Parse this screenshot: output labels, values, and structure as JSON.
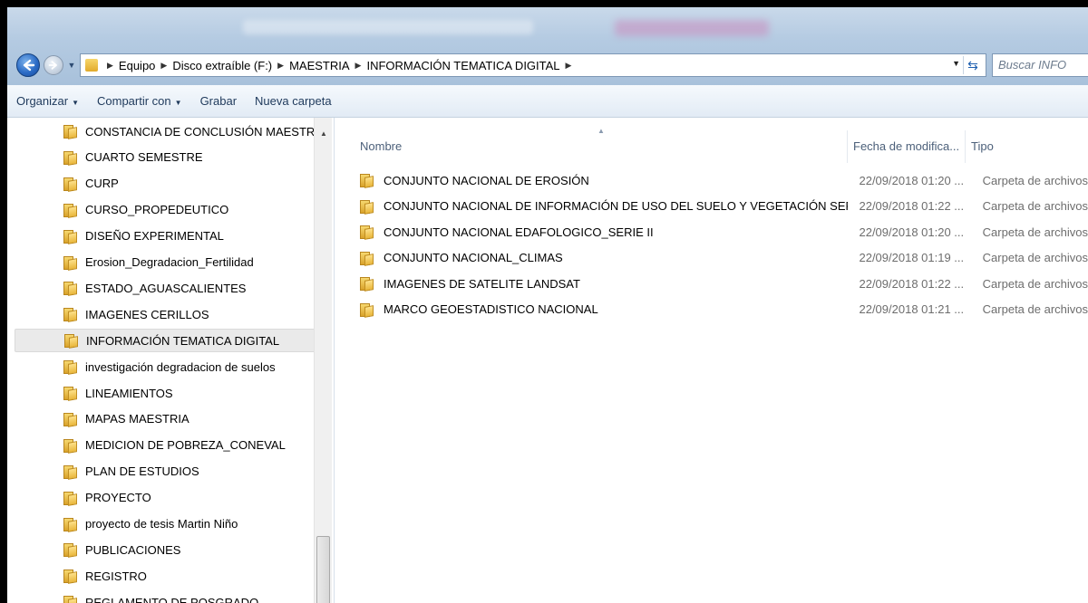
{
  "address": {
    "crumbs": [
      "Equipo",
      "Disco extraíble (F:)",
      "MAESTRIA",
      "INFORMACIÓN TEMATICA DIGITAL"
    ]
  },
  "search": {
    "placeholder": "Buscar INFO"
  },
  "toolbar": {
    "organize": "Organizar",
    "share": "Compartir con",
    "burn": "Grabar",
    "new_folder": "Nueva carpeta"
  },
  "sidebar": {
    "items": [
      "CONSTANCIA DE CONCLUSIÓN MAESTRÍA",
      "CUARTO SEMESTRE",
      "CURP",
      "CURSO_PROPEDEUTICO",
      "DISEÑO EXPERIMENTAL",
      "Erosion_Degradacion_Fertilidad",
      "ESTADO_AGUASCALIENTES",
      "IMAGENES CERILLOS",
      "INFORMACIÓN TEMATICA DIGITAL",
      "investigación degradacion de suelos",
      "LINEAMIENTOS",
      "MAPAS MAESTRIA",
      "MEDICION DE POBREZA_CONEVAL",
      "PLAN DE ESTUDIOS",
      "PROYECTO",
      "proyecto de tesis Martin Niño",
      "PUBLICACIONES",
      "REGISTRO",
      "REGLAMENTO DE POSGRADO"
    ],
    "selected": "INFORMACIÓN TEMATICA DIGITAL"
  },
  "columns": {
    "name": "Nombre",
    "date": "Fecha de modifica...",
    "type": "Tipo"
  },
  "files": [
    {
      "name": "CONJUNTO NACIONAL DE EROSIÓN",
      "date": "22/09/2018 01:20 ...",
      "type": "Carpeta de archivos"
    },
    {
      "name": "CONJUNTO NACIONAL DE INFORMACIÓN DE USO DEL SUELO Y VEGETACIÓN SERIE V",
      "date": "22/09/2018 01:22 ...",
      "type": "Carpeta de archivos"
    },
    {
      "name": "CONJUNTO NACIONAL EDAFOLOGICO_SERIE II",
      "date": "22/09/2018 01:20 ...",
      "type": "Carpeta de archivos"
    },
    {
      "name": "CONJUNTO NACIONAL_CLIMAS",
      "date": "22/09/2018 01:19 ...",
      "type": "Carpeta de archivos"
    },
    {
      "name": "IMAGENES DE SATELITE LANDSAT",
      "date": "22/09/2018 01:22 ...",
      "type": "Carpeta de archivos"
    },
    {
      "name": "MARCO GEOESTADISTICO NACIONAL",
      "date": "22/09/2018 01:21 ...",
      "type": "Carpeta de archivos"
    }
  ]
}
